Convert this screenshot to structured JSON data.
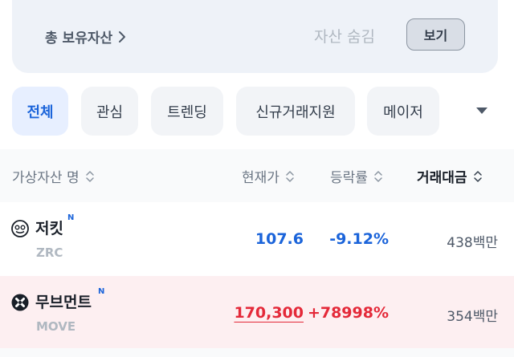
{
  "summary": {
    "total_assets_label": "총 보유자산",
    "hide_assets_label": "자산 숨김",
    "view_button_label": "보기"
  },
  "tabs": [
    {
      "label": "전체",
      "active": true
    },
    {
      "label": "관심",
      "active": false
    },
    {
      "label": "트렌딩",
      "active": false
    },
    {
      "label": "신규거래지원",
      "active": false
    },
    {
      "label": "메이저",
      "active": false
    }
  ],
  "table": {
    "headers": {
      "name": "가상자산 명",
      "price": "현재가",
      "change": "등락률",
      "volume": "거래대금"
    },
    "rows": [
      {
        "name": "저킷",
        "badge": "N",
        "ticker": "ZRC",
        "price": "107.6",
        "change": "-9.12%",
        "volume": "438백만",
        "icon": "zrc-coin-icon"
      },
      {
        "name": "무브먼트",
        "badge": "N",
        "ticker": "MOVE",
        "price": "170,300",
        "change": "+78998%",
        "volume": "354백만",
        "icon": "move-coin-icon"
      }
    ]
  },
  "colors": {
    "accent": "#1b64da",
    "rise": "#e42939",
    "fall": "#1b64da",
    "highlight_row": "#fdeff1"
  }
}
